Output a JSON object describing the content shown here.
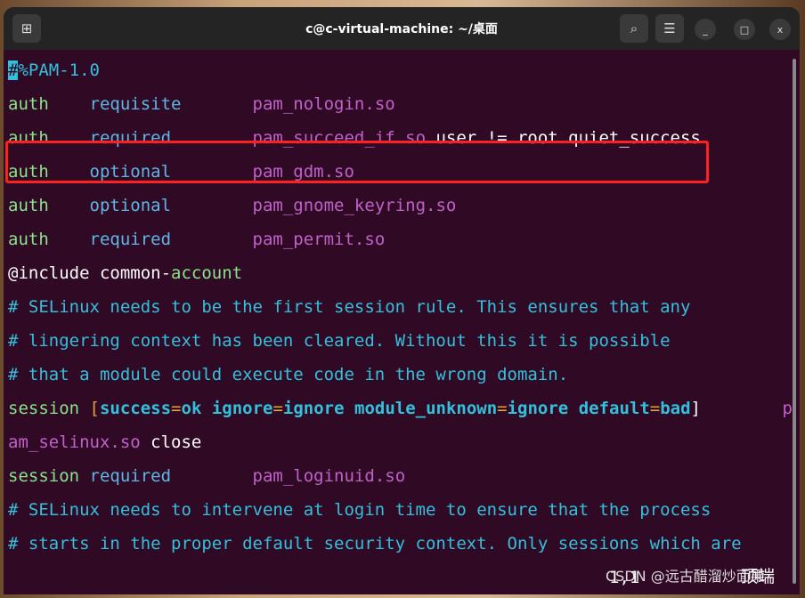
{
  "window": {
    "title": "c@c-virtual-machine: ~/桌面",
    "new_tab_icon": "new-tab-icon",
    "search_icon": "search-icon",
    "menu_icon": "hamburger-icon",
    "minimize": "_",
    "maximize": "□",
    "close": "x"
  },
  "colors": {
    "background": "#300a24",
    "keyword": "#8ae28a",
    "control": "#5eb6e6",
    "module": "#c061cb",
    "comment": "#33c0dc",
    "highlight_box": "#ff2020"
  },
  "lines": [
    {
      "a": "#",
      "b": "%PAM-1.0"
    },
    {
      "a": "auth    ",
      "b": "requisite       ",
      "c": "pam_nologin.so"
    },
    {
      "a": "auth    ",
      "b": "required        ",
      "c": "pam_succeed_if.so",
      "d": " user != root quiet_success"
    },
    {
      "a": "auth    ",
      "b": "optional        ",
      "c": "pam_gdm.so"
    },
    {
      "a": "auth    ",
      "b": "optional        ",
      "c": "pam_gnome_keyring.so"
    },
    {
      "a": "auth    ",
      "b": "required        ",
      "c": "pam_permit.so"
    },
    {
      "a": "@include common-",
      "b": "account"
    },
    {
      "a": "# SELinux needs to be the first session rule. This ensures that any"
    },
    {
      "a": "# lingering context has been cleared. Without this it is possible"
    },
    {
      "a": "# that a module could execute code in the wrong domain."
    },
    {
      "a": "session ",
      "p1": "[",
      "k1": "success",
      "e1": "=",
      "v1": "ok",
      "k2": " ignore",
      "e2": "=",
      "v2": "ignore",
      "k3": " module_unknown",
      "e3": "=",
      "v3": "ignore",
      "k4": " default",
      "e4": "=",
      "v4": "bad",
      "p2": "]",
      "sp": "        ",
      "m": "p"
    },
    {
      "a": "am_selinux.so",
      "b": " close"
    },
    {
      "a": "session ",
      "b": "required        ",
      "c": "pam_loginuid.so"
    },
    {
      "a": "# SELinux needs to intervene at login time to ensure that the process"
    },
    {
      "a": "# starts in the proper default security context. Only sessions which are"
    }
  ],
  "status": {
    "position": "1,1",
    "scroll": "顶端"
  },
  "watermark": "CSDN @远古醋溜炒面果"
}
